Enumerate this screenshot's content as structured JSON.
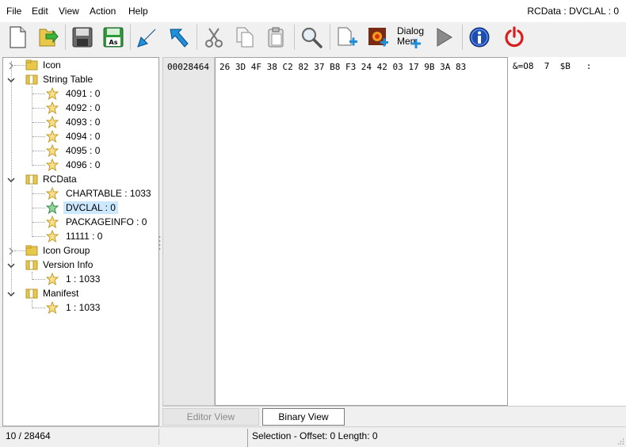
{
  "window": {
    "title": "RCData : DVCLAL : 0"
  },
  "menu": {
    "items": [
      {
        "label": "File"
      },
      {
        "label": "Edit"
      },
      {
        "label": "View"
      },
      {
        "label": "Action"
      },
      {
        "label": "Help"
      }
    ]
  },
  "toolbar": {
    "dialog_menu_line1": "Dialog",
    "dialog_menu_line2": "Men",
    "icons": [
      "new-file-icon",
      "open-folder-icon",
      "save-icon",
      "save-as-icon",
      "import-icon",
      "export-icon",
      "cut-icon",
      "copy-icon",
      "paste-icon",
      "find-icon",
      "add-resource-icon",
      "add-image-icon",
      "add-dialog-menu-icon",
      "run-script-icon",
      "info-icon",
      "power-icon"
    ]
  },
  "tree": {
    "icon_label": "Icon",
    "string_table_label": "String Table",
    "string_items": [
      "4091 : 0",
      "4092 : 0",
      "4093 : 0",
      "4094 : 0",
      "4095 : 0",
      "4096 : 0"
    ],
    "rcdata_label": "RCData",
    "rcdata_items": [
      "CHARTABLE : 1033",
      "DVCLAL : 0",
      "PACKAGEINFO : 0",
      "11111 : 0"
    ],
    "selected": "DVCLAL : 0",
    "icon_group_label": "Icon Group",
    "version_info_label": "Version Info",
    "version_info_items": [
      "1 : 1033"
    ],
    "manifest_label": "Manifest",
    "manifest_items": [
      "1 : 1033"
    ]
  },
  "hex": {
    "offset": "00028464",
    "bytes": "26 3D 4F 38 C2 82 37 B8 F3 24 42 03 17 9B 3A 83",
    "ascii": "&=O8  7  $B   :"
  },
  "tabs": {
    "editor_view": "Editor View",
    "binary_view": "Binary View"
  },
  "status": {
    "position": "10 / 28464",
    "selection": "Selection - Offset: 0 Length: 0"
  },
  "colors": {
    "selection_bg": "#cce8ff",
    "folder_yellow": "#e8c84a",
    "arrow_blue": "#1e8fd8",
    "power_red": "#d81e1e",
    "info_blue": "#1e4fb0"
  }
}
